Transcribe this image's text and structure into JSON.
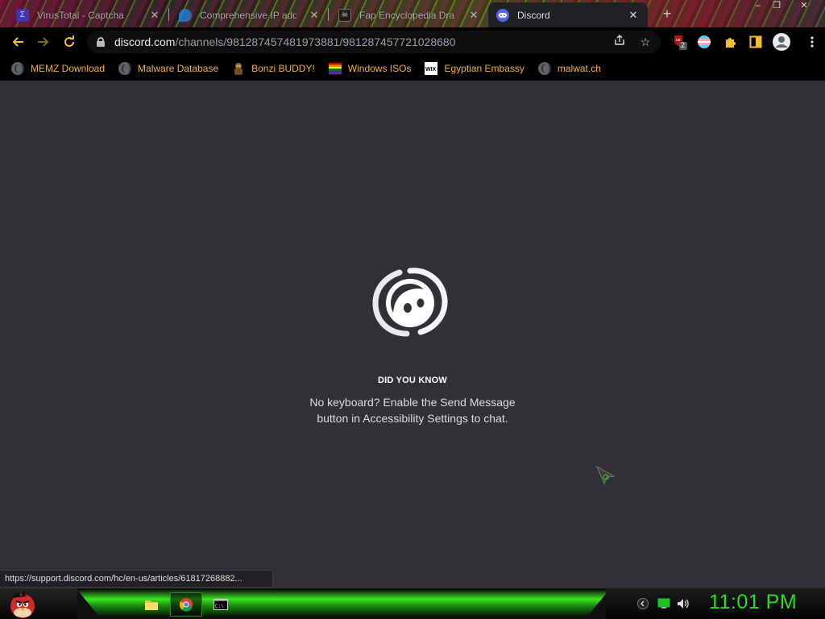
{
  "browser": {
    "tabs": [
      {
        "title": "VirusTotal - Captcha",
        "favicon": "virustotal-icon",
        "active": false
      },
      {
        "title": "Comprehensive IP addr",
        "favicon": "location-pin-icon",
        "active": false
      },
      {
        "title": "Fap Encyclopedia Dra",
        "favicon": "skull-icon",
        "active": false
      },
      {
        "title": "Discord",
        "favicon": "discord-icon",
        "active": true
      }
    ],
    "new_tab_label": "+",
    "window_controls": {
      "minimize": "–",
      "maximize": "❐",
      "close": "✕"
    },
    "address": {
      "host": "discord.com",
      "path": "/channels/981287457481973881/981287457721028680"
    },
    "extension_badge": "2",
    "accent": "#f4b23c"
  },
  "bookmarks": [
    {
      "label": "MEMZ Download",
      "icon": "globe-icon"
    },
    {
      "label": "Malware Database",
      "icon": "globe-icon"
    },
    {
      "label": "Bonzi BUDDY!",
      "icon": "bonzi-icon"
    },
    {
      "label": "Windows ISOs",
      "icon": "rainbow-flag-icon"
    },
    {
      "label": "Egyptian Embassy",
      "icon": "wix-icon"
    },
    {
      "label": "malwat.ch",
      "icon": "globe-icon"
    }
  ],
  "loading": {
    "title": "DID YOU KNOW",
    "line1": "No keyboard? Enable the Send Message",
    "line2": "button in Accessibility Settings to chat."
  },
  "status_url": "https://support.discord.com/hc/en-us/articles/61817268882...",
  "taskbar": {
    "clock": "11:01 PM",
    "apps": [
      "file-explorer-icon",
      "chrome-icon",
      "command-prompt-icon"
    ],
    "tray": [
      "arrow-icon",
      "network-icon",
      "volume-icon"
    ],
    "accent": "#25e11a"
  }
}
